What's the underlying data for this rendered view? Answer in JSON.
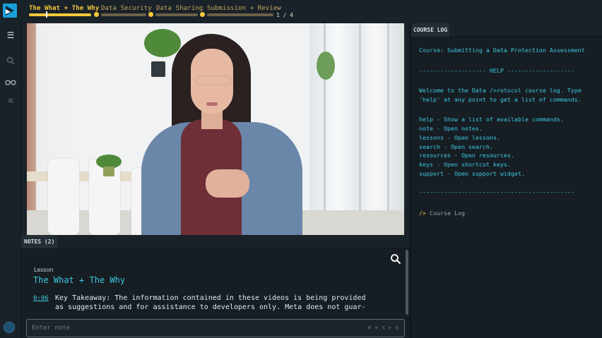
{
  "header": {
    "tabs": [
      {
        "label": "The What + The Why",
        "active": true
      },
      {
        "label": "Data Security",
        "active": false
      },
      {
        "label": "Data Sharing",
        "active": false
      },
      {
        "label": "Submission + Review",
        "active": false
      }
    ],
    "progress": "1 / 4",
    "colors": {
      "accent": "#f5c93a",
      "accent_muted": "#6e6146",
      "link": "#3ec9e0"
    }
  },
  "rail": {
    "icons": [
      "list-icon",
      "search-icon",
      "glasses-icon",
      "command-icon",
      "help-icon"
    ]
  },
  "notes": {
    "header": "NOTES (2)",
    "kind": "Lesson",
    "title": "The What + The Why",
    "entry": {
      "time": "0:06",
      "lines": [
        "Key Takeaway: The information contained in these videos is being provided",
        "as suggestions and for assistance to developers only. Meta does not guar-"
      ]
    },
    "input_placeholder": "Enter note",
    "shortcut": "⌘ + ⌥ + n"
  },
  "course_log": {
    "header": "COURSE LOG",
    "course": "Course: Submitting a Data Protection Assessment",
    "help_divider": "------------------- HELP -------------------",
    "welcome_1": "Welcome to the Data />rotocol course log. Type",
    "welcome_2": "'help' at any point to get a list of commands.",
    "commands": [
      "help - Show a list of available commands.",
      "note - Open notes.",
      "lessons - Open lessons.",
      "search - Open search.",
      "resources - Open resources.",
      "keys - Open shortcut keys.",
      "support - Open support widget."
    ],
    "end_divider": "--------------------------------------------",
    "prompt": "/>",
    "prompt_text": "Course Log"
  }
}
